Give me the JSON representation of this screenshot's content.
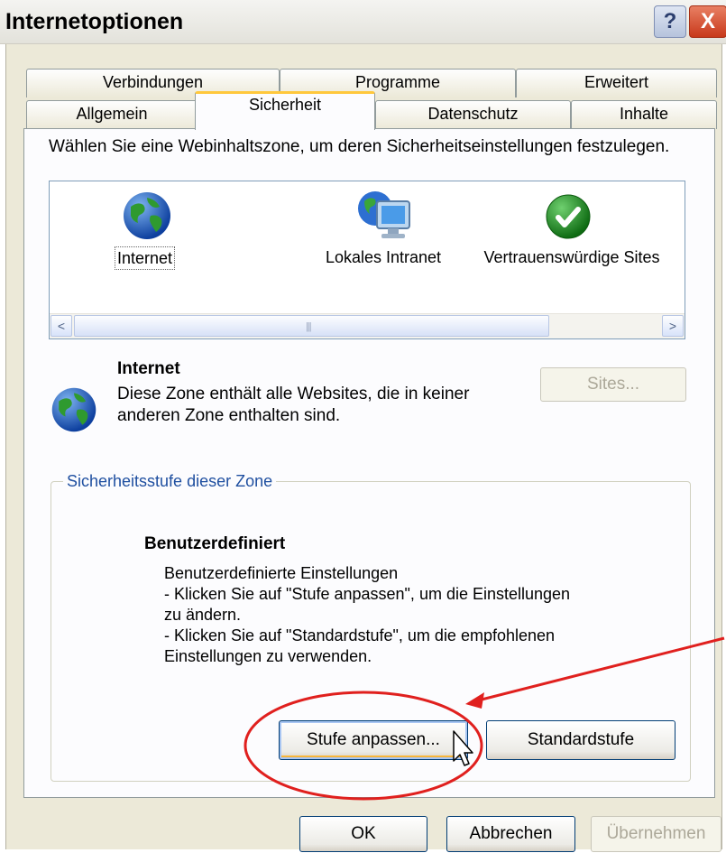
{
  "window": {
    "title": "Internetoptionen",
    "help_label": "?",
    "close_label": "X"
  },
  "tabs": {
    "row1": [
      "Verbindungen",
      "Programme",
      "Erweitert"
    ],
    "row2": [
      "Allgemein",
      "Sicherheit",
      "Datenschutz",
      "Inhalte"
    ],
    "active": "Sicherheit"
  },
  "security": {
    "instruction": "Wählen Sie eine Webinhaltszone, um deren Sicherheitseinstellungen festzulegen.",
    "zones": [
      {
        "label": "Internet",
        "icon": "globe-icon",
        "selected": true
      },
      {
        "label": "Lokales Intranet",
        "icon": "intranet-monitor-icon",
        "selected": false
      },
      {
        "label": "Vertrauenswürdige Sites",
        "icon": "trusted-check-icon",
        "selected": false
      }
    ],
    "scroll_left": "<",
    "scroll_right": ">",
    "selected_zone_title": "Internet",
    "selected_zone_desc": "Diese Zone enthält alle Websites, die in keiner anderen Zone enthalten sind.",
    "sites_button": "Sites...",
    "level_group_label": "Sicherheitsstufe dieser Zone",
    "level_title": "Benutzerdefiniert",
    "level_desc_lines": [
      "Benutzerdefinierte Einstellungen",
      "- Klicken Sie auf \"Stufe anpassen\", um die Einstellungen",
      "zu ändern.",
      "- Klicken Sie auf \"Standardstufe\", um die empfohlenen",
      "Einstellungen zu verwenden."
    ],
    "custom_level_button": "Stufe anpassen...",
    "default_level_button": "Standardstufe"
  },
  "footer": {
    "ok": "OK",
    "cancel": "Abbrechen",
    "apply": "Übernehmen"
  },
  "colors": {
    "annotation": "#e0201e",
    "focus_accent": "#ffc83c",
    "group_label": "#1f4fa0"
  }
}
